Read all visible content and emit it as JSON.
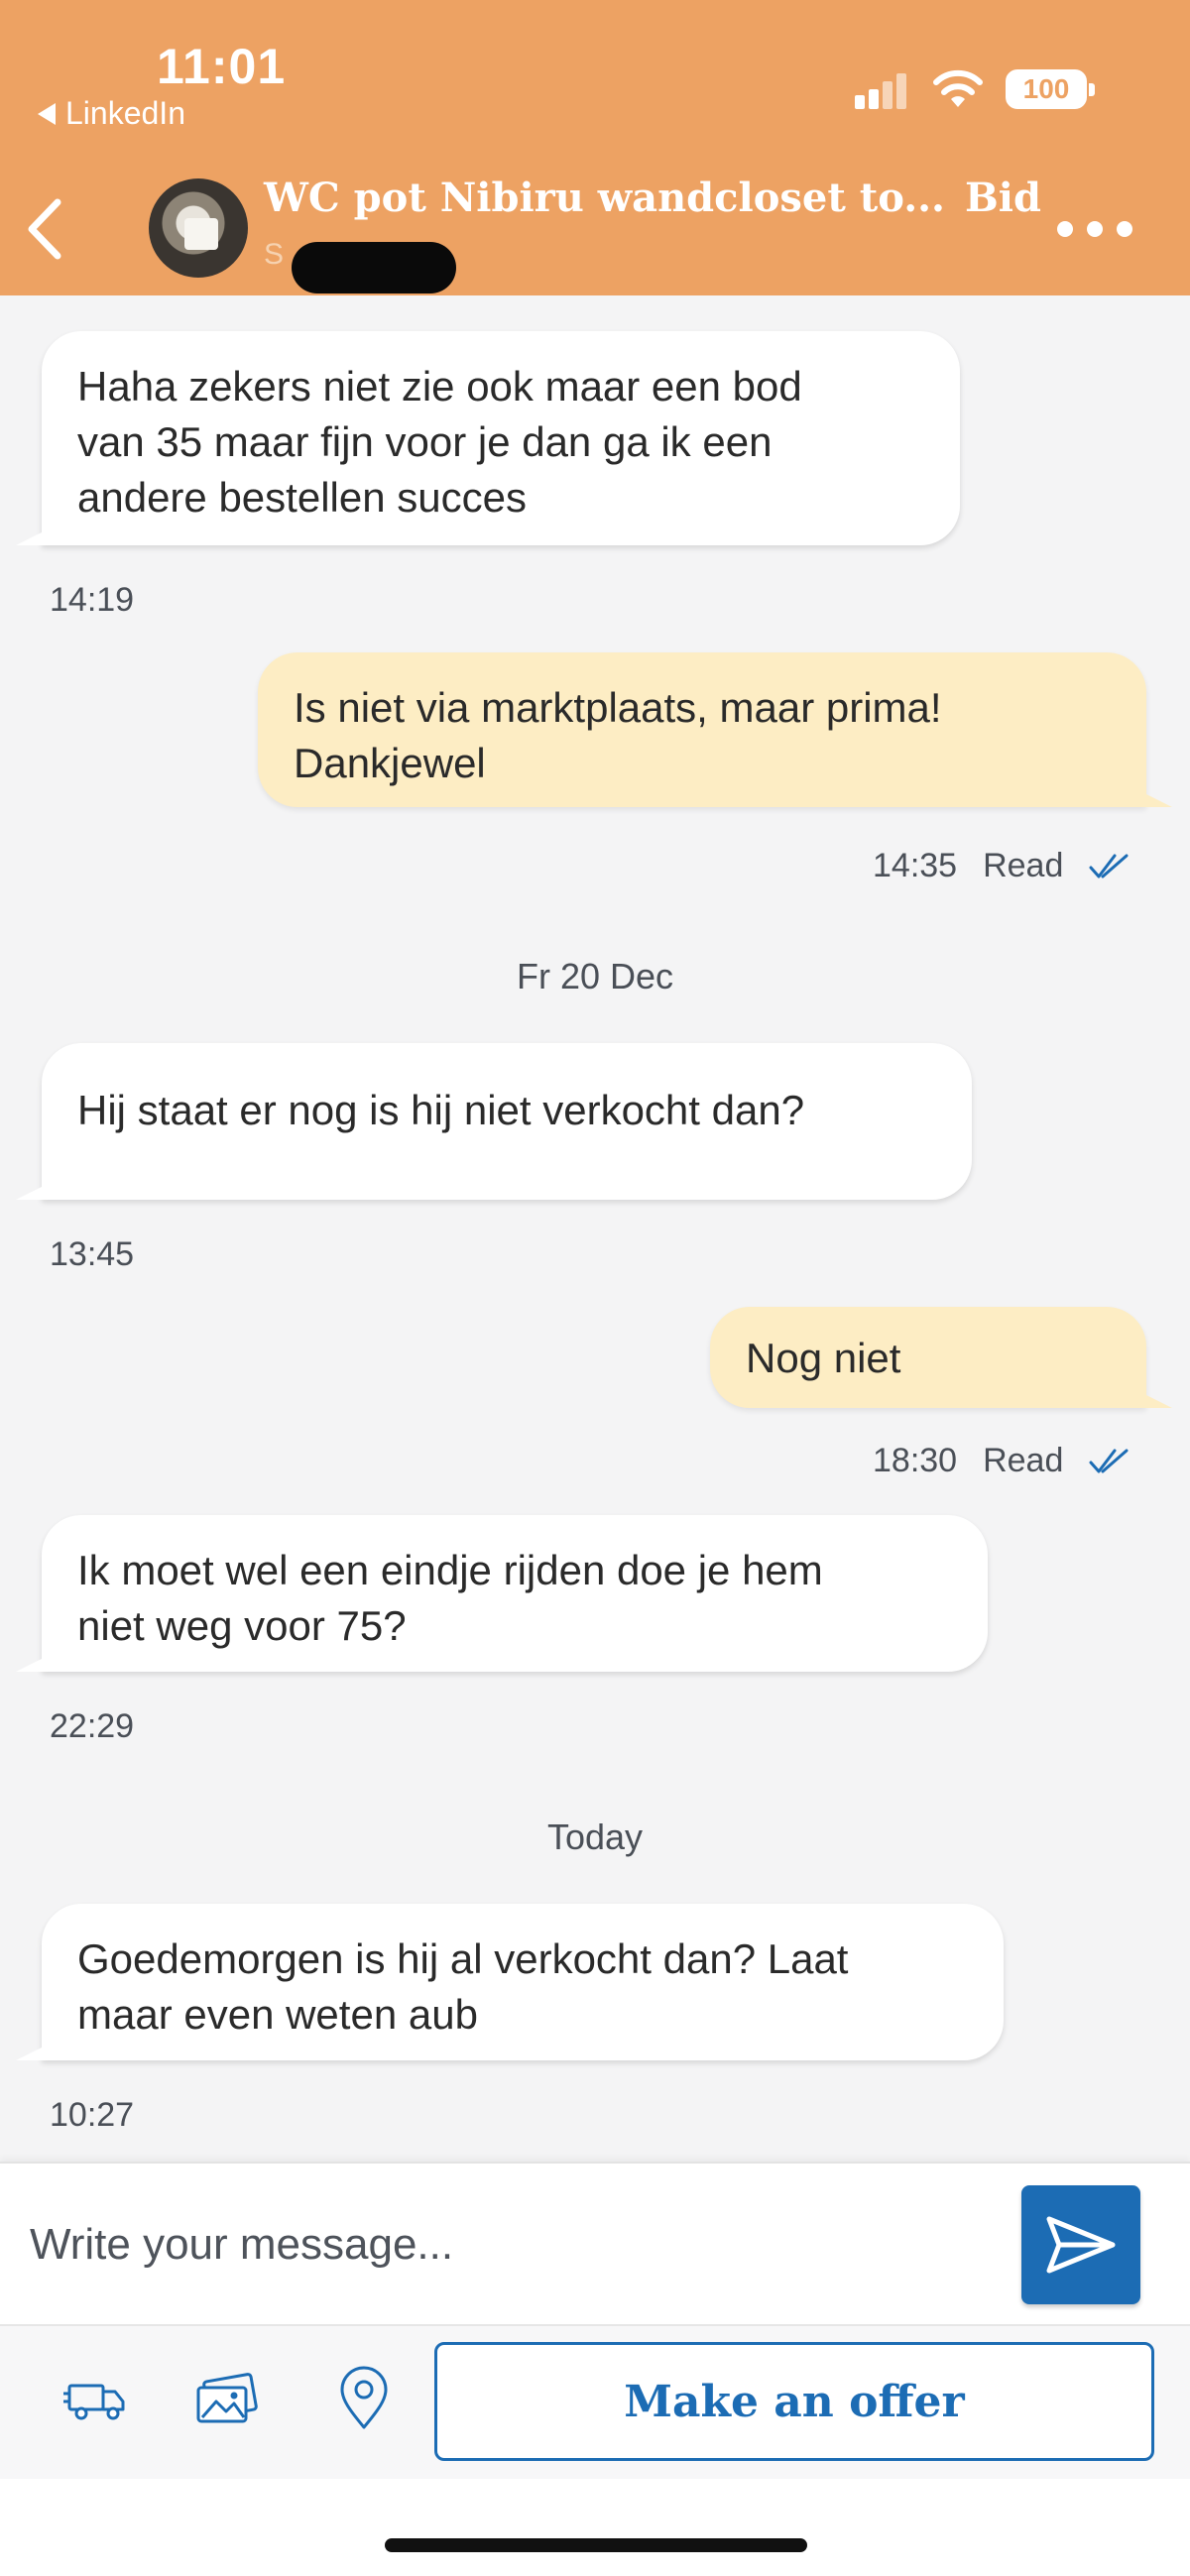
{
  "status_bar": {
    "time": "11:01",
    "back_app": "LinkedIn",
    "battery": "100"
  },
  "header": {
    "title": "WC pot Nibiru wandcloset to...",
    "title_suffix": "Bid",
    "subtitle": "S",
    "back_icon": "chevron-left-icon",
    "more_icon": "more-dots-icon",
    "header_color": "#eda263"
  },
  "conversation": {
    "messages": [
      {
        "direction": "incoming",
        "text": "Haha zekers niet zie ook maar een bod\nvan 35 maar fijn voor je dan ga ik een\nandere bestellen succes",
        "time": "14:19"
      },
      {
        "direction": "outgoing",
        "text": "Is niet via marktplaats, maar prima!\nDankjewel",
        "time": "14:35",
        "status": "Read"
      },
      {
        "type": "date",
        "label": "Fr 20 Dec"
      },
      {
        "direction": "incoming",
        "text": "Hij staat er nog is hij niet verkocht dan?",
        "time": "13:45"
      },
      {
        "direction": "outgoing",
        "text": "Nog niet",
        "time": "18:30",
        "status": "Read"
      },
      {
        "direction": "incoming",
        "text": "Ik moet wel een eindje rijden doe je hem\nniet weg voor 75?",
        "time": "22:29"
      },
      {
        "type": "date",
        "label": "Today"
      },
      {
        "direction": "incoming",
        "text": "Goedemorgen is hij al verkocht dan? Laat\nmaar even weten aub",
        "time": "10:27"
      }
    ],
    "incoming_bubble_color": "#ffffff",
    "outgoing_bubble_color": "#fdedc4",
    "read_check_color": "#1c6cb4"
  },
  "composer": {
    "placeholder": "Write your message...",
    "send_icon": "send-icon",
    "send_color": "#1c6cb4"
  },
  "toolbar": {
    "icons": [
      "delivery-truck-icon",
      "image-gallery-icon",
      "location-pin-icon"
    ],
    "offer_label": "Make an offer"
  }
}
